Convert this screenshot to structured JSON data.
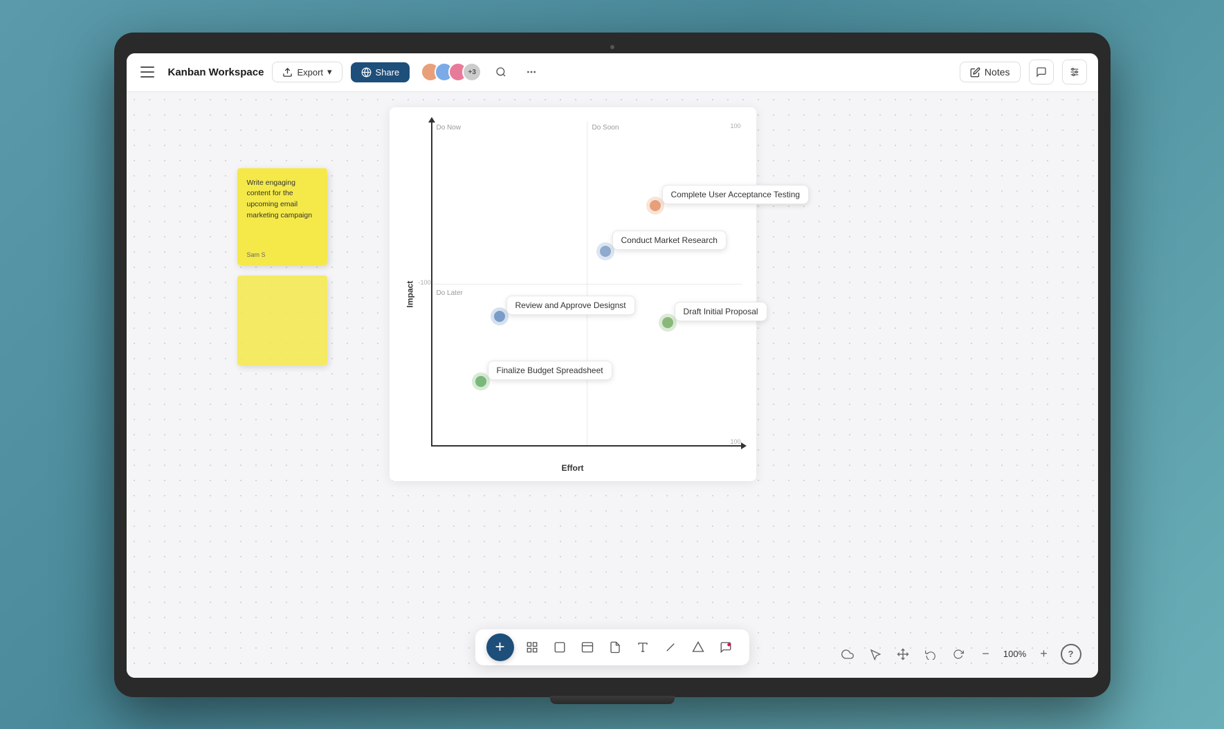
{
  "header": {
    "menu_label": "Menu",
    "title": "Kanban Workspace",
    "export_label": "Export",
    "share_label": "Share",
    "notes_label": "Notes",
    "avatar_count": "+3",
    "zoom": "100%"
  },
  "sticky_notes": [
    {
      "id": "note-1",
      "text": "Write engaging content for the upcoming email marketing campaign",
      "author": "Sam S"
    },
    {
      "id": "note-2",
      "text": "",
      "author": ""
    }
  ],
  "chart": {
    "axis_x_label": "Effort",
    "axis_y_label": "Impact",
    "quadrant_labels": {
      "do_now": "Do Now",
      "do_soon": "Do Soon",
      "do_later": "Do Later"
    },
    "tick_100_top": "100",
    "tick_100_right": "100",
    "tick_neg100": "-100",
    "data_points": [
      {
        "id": "point-uat",
        "label": "Complete User Acceptance Testing",
        "x_pct": 78,
        "y_pct": 28,
        "color": "#e8a87c",
        "outer_color": "rgba(232,168,124,0.3)",
        "size": 14,
        "outer_size": 22
      },
      {
        "id": "point-market",
        "label": "Conduct Market Research",
        "x_pct": 62,
        "y_pct": 40,
        "color": "#8eaacc",
        "outer_color": "rgba(142,170,204,0.3)",
        "size": 14,
        "outer_size": 22
      },
      {
        "id": "point-design",
        "label": "Review and Approve Designst",
        "x_pct": 28,
        "y_pct": 60,
        "color": "#7a9cc8",
        "outer_color": "rgba(122,156,200,0.3)",
        "size": 14,
        "outer_size": 22
      },
      {
        "id": "point-proposal",
        "label": "Draft Initial Proposal",
        "x_pct": 80,
        "y_pct": 62,
        "color": "#8ab87a",
        "outer_color": "rgba(138,184,122,0.3)",
        "size": 14,
        "outer_size": 22
      },
      {
        "id": "point-budget",
        "label": "Finalize Budget Spreadsheet",
        "x_pct": 22,
        "y_pct": 80,
        "color": "#7ab87a",
        "outer_color": "rgba(122,184,122,0.3)",
        "size": 14,
        "outer_size": 22
      }
    ]
  },
  "toolbar": {
    "add_label": "+",
    "tools": [
      "grid-icon",
      "rect-icon",
      "panel-icon",
      "note-icon",
      "text-icon",
      "line-icon",
      "triangle-icon",
      "chat-icon"
    ]
  },
  "bottom_controls": {
    "cloud_label": "☁",
    "pointer_label": "↖",
    "move_label": "⊕",
    "undo_label": "↩",
    "redo_label": "↪",
    "zoom_out_label": "−",
    "zoom_in_label": "+",
    "zoom_value": "100%",
    "help_label": "?"
  }
}
